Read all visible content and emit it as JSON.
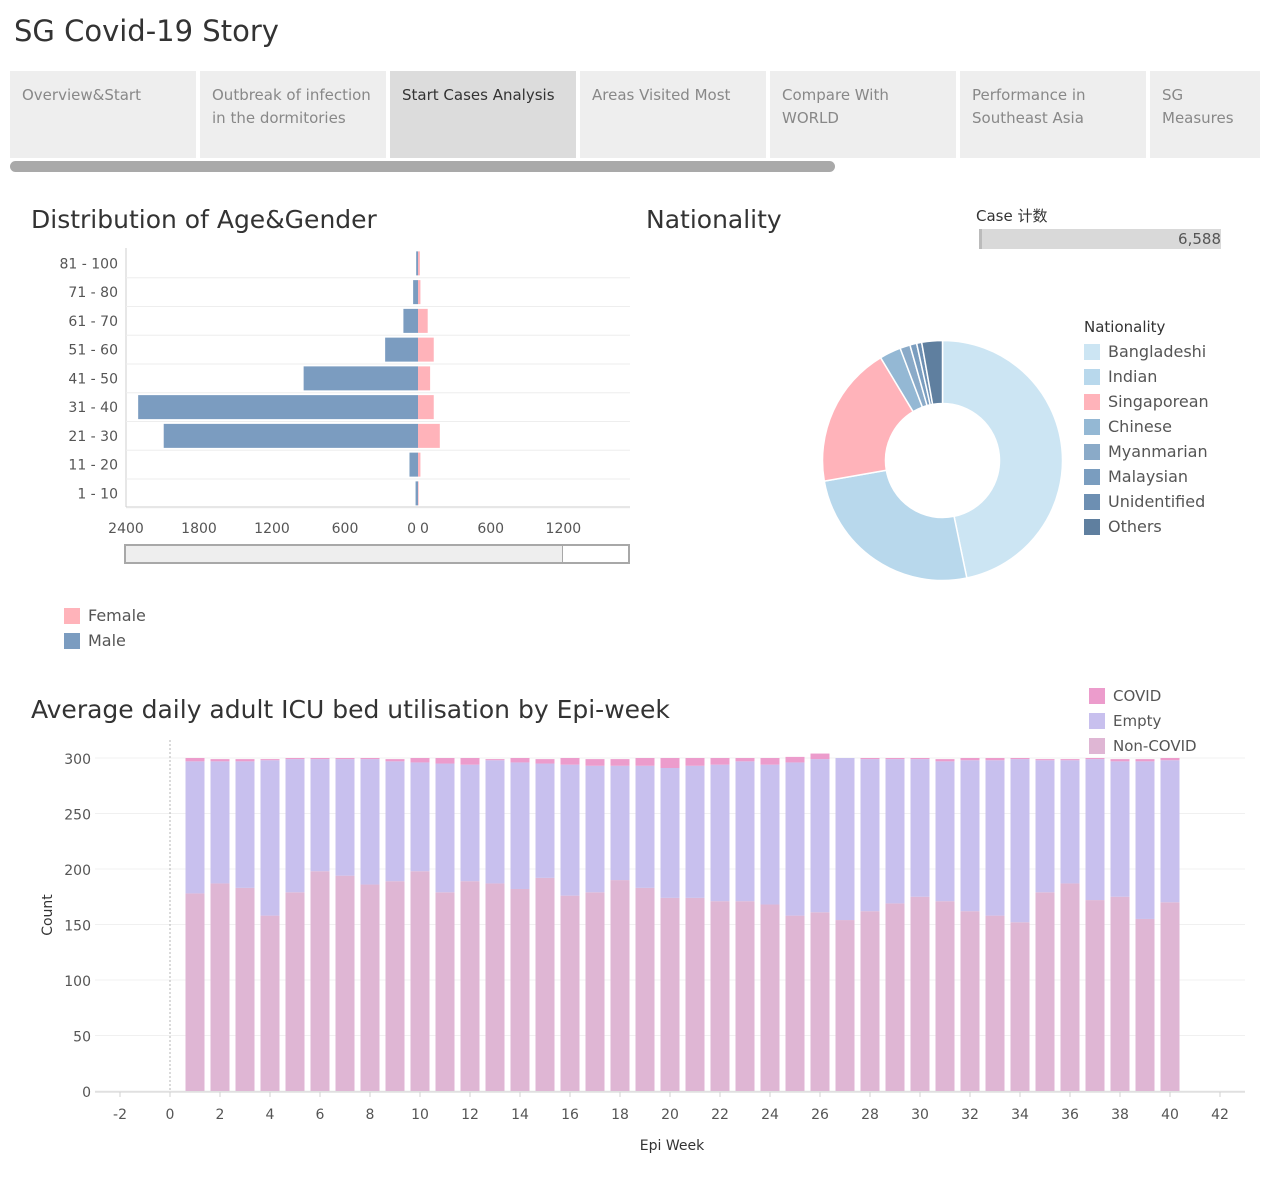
{
  "story_title": "SG Covid-19 Story",
  "tabs": [
    {
      "label": "Overview&Start",
      "active": false
    },
    {
      "label": "Outbreak of infection in the dormitories",
      "active": false
    },
    {
      "label": "Start Cases Analysis",
      "active": true
    },
    {
      "label": "Areas Visited Most",
      "active": false
    },
    {
      "label": "Compare With  WORLD",
      "active": false
    },
    {
      "label": "Performance in Southeast Asia",
      "active": false
    },
    {
      "label": "SG Measures",
      "active": false
    }
  ],
  "age_gender": {
    "title": "Distribution of Age&Gender",
    "legend": [
      {
        "label": "Female",
        "color": "#ffb3ba"
      },
      {
        "label": "Male",
        "color": "#7b9cc0"
      }
    ]
  },
  "nationality": {
    "title": "Nationality",
    "kpi_label": "Case 计数",
    "kpi_value": "6,588",
    "legend_title": "Nationality"
  },
  "icu": {
    "title": "Average daily adult ICU bed utilisation by Epi-week"
  },
  "chart_data": [
    {
      "type": "bar",
      "orientation": "horizontal-diverging",
      "title": "Distribution of Age&Gender",
      "categories": [
        "81 - 100",
        "71 - 80",
        "61 - 70",
        "51 - 60",
        "41 - 50",
        "31 - 40",
        "21 - 30",
        "11 - 20",
        "1 - 10"
      ],
      "series": [
        {
          "name": "Male",
          "color": "#7b9cc0",
          "values": [
            15,
            40,
            120,
            270,
            940,
            2300,
            2090,
            70,
            20
          ]
        },
        {
          "name": "Female",
          "color": "#ffb3ba",
          "values": [
            15,
            20,
            80,
            130,
            100,
            130,
            180,
            20,
            5
          ]
        }
      ],
      "male_axis_ticks": [
        "2400",
        "1800",
        "1200",
        "600",
        "0"
      ],
      "female_axis_ticks": [
        "0",
        "600",
        "1200"
      ],
      "xlim_male": [
        0,
        2400
      ],
      "xlim_female": [
        0,
        1750
      ],
      "legend_position": "bottom-left"
    },
    {
      "type": "pie",
      "donut": true,
      "title": "Nationality",
      "legend_title": "Nationality",
      "legend_position": "right",
      "total": 6588,
      "slices": [
        {
          "label": "Bangladeshi",
          "value": 3080,
          "color": "#cce5f3"
        },
        {
          "label": "Indian",
          "value": 1680,
          "color": "#b8d8ec"
        },
        {
          "label": "Singaporean",
          "value": 1260,
          "color": "#ffb3ba"
        },
        {
          "label": "Chinese",
          "value": 190,
          "color": "#94b8d4"
        },
        {
          "label": "Myanmarian",
          "value": 90,
          "color": "#8aaac8"
        },
        {
          "label": "Malaysian",
          "value": 60,
          "color": "#7a9dbf"
        },
        {
          "label": "Unidentified",
          "value": 45,
          "color": "#6d8fb2"
        },
        {
          "label": "Others",
          "value": 183,
          "color": "#5f7f9f"
        }
      ]
    },
    {
      "type": "bar",
      "stacked": true,
      "title": "Average daily adult ICU bed utilisation by Epi-week",
      "xlabel": "Epi Week",
      "ylabel": "Count",
      "xlim": [
        -3,
        43
      ],
      "ylim": [
        0,
        300
      ],
      "x_ticks": [
        "-2",
        "0",
        "2",
        "4",
        "6",
        "8",
        "10",
        "12",
        "14",
        "16",
        "18",
        "20",
        "22",
        "24",
        "26",
        "28",
        "30",
        "32",
        "34",
        "36",
        "38",
        "40",
        "42"
      ],
      "y_ticks": [
        "300",
        "250",
        "200",
        "150",
        "100",
        "50",
        "0"
      ],
      "legend_position": "top-right",
      "x": [
        1,
        2,
        3,
        4,
        5,
        6,
        7,
        8,
        9,
        10,
        11,
        12,
        13,
        14,
        15,
        16,
        17,
        18,
        19,
        20,
        21,
        22,
        23,
        24,
        25,
        26,
        27,
        28,
        29,
        30,
        31,
        32,
        33,
        34,
        35,
        36,
        37,
        38,
        39,
        40
      ],
      "series": [
        {
          "name": "Non-COVID",
          "color": "#dfb6d4",
          "values": [
            178,
            187,
            183,
            158,
            179,
            198,
            194,
            186,
            189,
            198,
            179,
            189,
            187,
            182,
            192,
            176,
            179,
            190,
            183,
            174,
            174,
            171,
            171,
            168,
            158,
            161,
            154,
            162,
            169,
            175,
            171,
            162,
            158,
            152,
            179,
            187,
            172,
            175,
            155,
            170
          ]
        },
        {
          "name": "Empty",
          "color": "#c8c0ee",
          "values": [
            119,
            110,
            114,
            140,
            120,
            101,
            105,
            113,
            108,
            98,
            116,
            105,
            111,
            114,
            103,
            118,
            114,
            103,
            110,
            117,
            119,
            123,
            126,
            126,
            138,
            138,
            146,
            137,
            130,
            124,
            126,
            136,
            140,
            147,
            119,
            111,
            127,
            122,
            142,
            128
          ]
        },
        {
          "name": "COVID",
          "color": "#ec9ccc",
          "values": [
            3,
            2,
            2,
            1,
            1,
            1,
            1,
            1,
            2,
            4,
            5,
            6,
            1,
            4,
            4,
            6,
            6,
            6,
            7,
            9,
            7,
            6,
            3,
            6,
            5,
            5,
            0,
            1,
            1,
            1,
            2,
            2,
            2,
            1,
            1,
            1,
            1,
            2,
            2,
            2
          ]
        }
      ]
    }
  ]
}
